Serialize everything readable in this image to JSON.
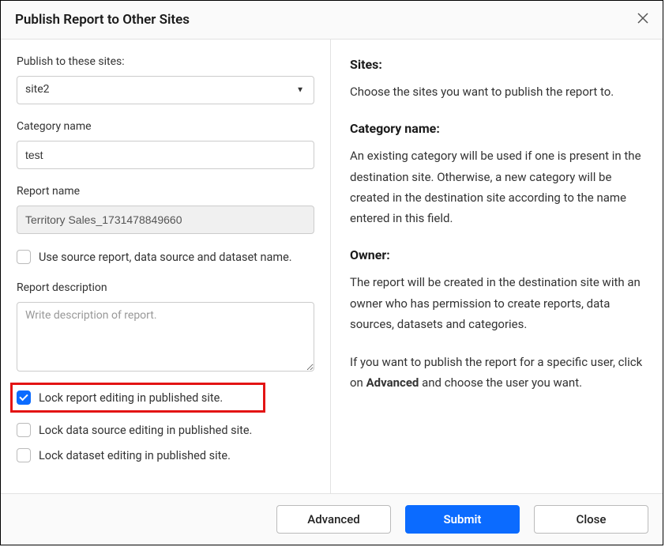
{
  "header": {
    "title": "Publish Report to Other Sites"
  },
  "form": {
    "sites_label": "Publish to these sites:",
    "sites_value": "site2",
    "category_label": "Category name",
    "category_value": "test",
    "report_name_label": "Report name",
    "report_name_value": "Territory Sales_1731478849660",
    "use_source_label": "Use source report, data source and dataset name.",
    "description_label": "Report description",
    "description_placeholder": "Write description of report.",
    "lock_report_label": "Lock report editing in published site.",
    "lock_datasource_label": "Lock data source editing in published site.",
    "lock_dataset_label": "Lock dataset editing in published site."
  },
  "info": {
    "sites_heading": "Sites:",
    "sites_text": "Choose the sites you want to publish the report to.",
    "category_heading": "Category name:",
    "category_text": "An existing category will be used if one is present in the destination site. Otherwise, a new category will be created in the destination site according to the name entered in this field.",
    "owner_heading": "Owner:",
    "owner_text": "The report will be created in the destination site with an owner who has permission to create reports, data sources, datasets and categories.",
    "owner_text2_pre": "If you want to publish the report for a specific user, click on ",
    "owner_text2_bold": "Advanced",
    "owner_text2_post": " and choose the user you want."
  },
  "footer": {
    "advanced": "Advanced",
    "submit": "Submit",
    "close": "Close"
  }
}
